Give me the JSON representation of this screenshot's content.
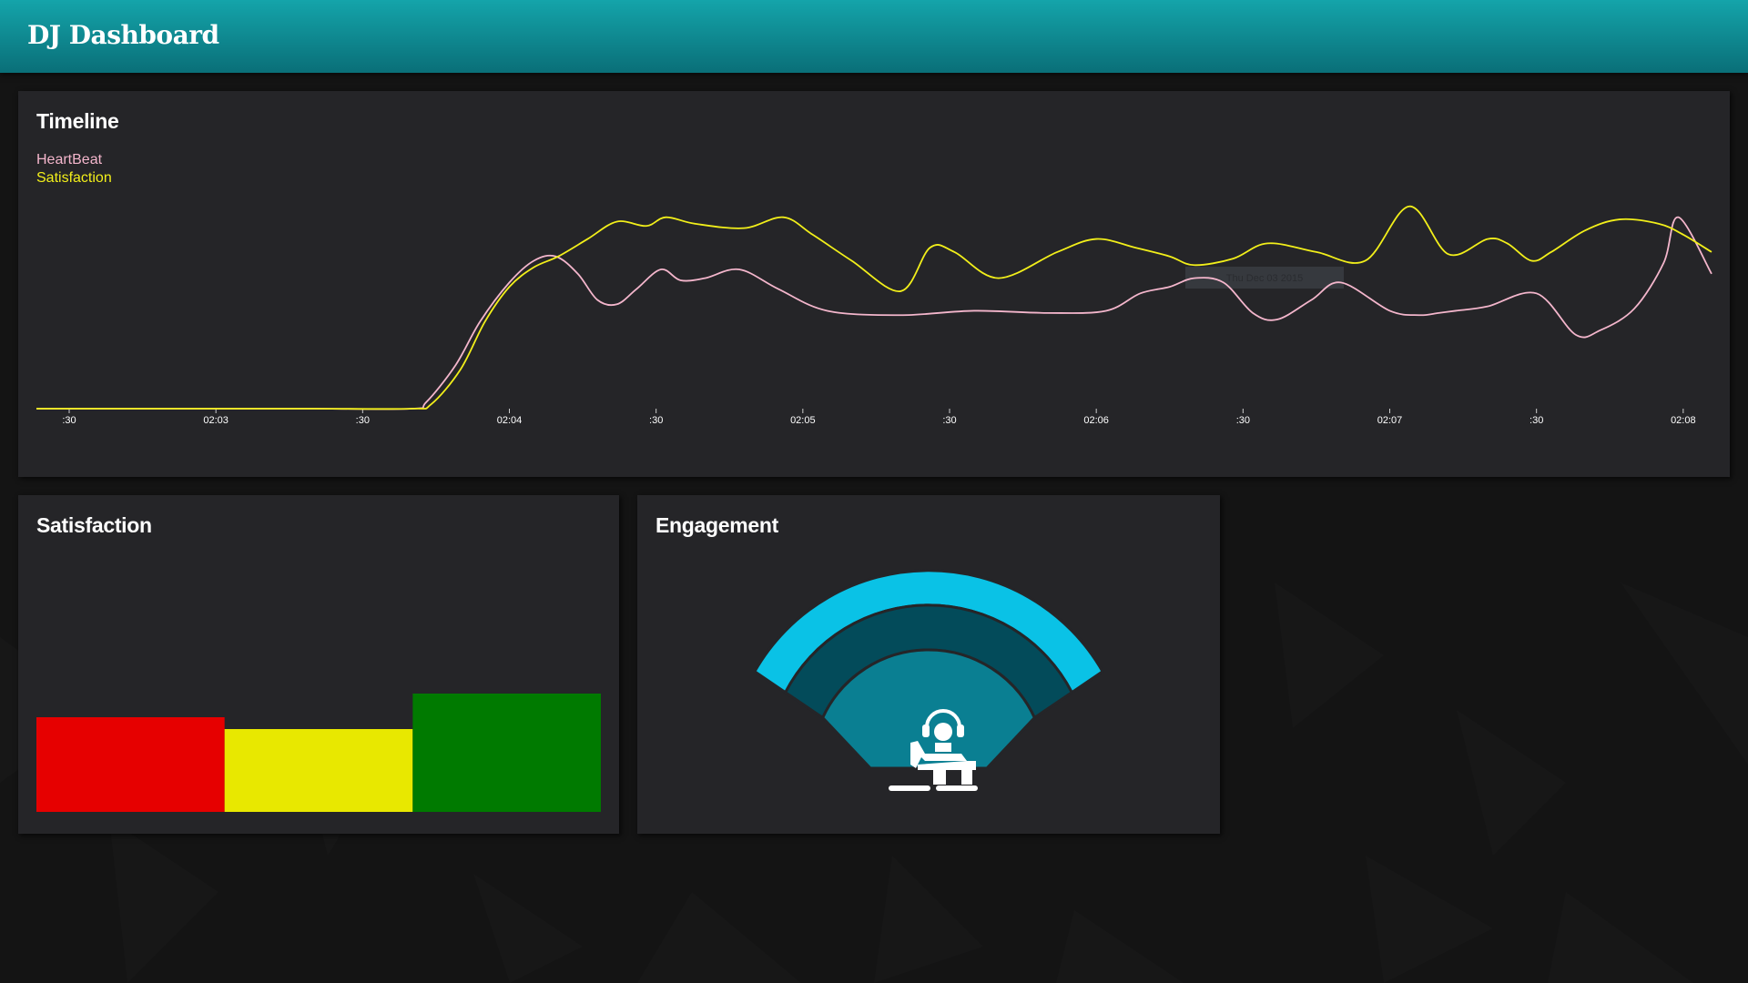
{
  "header": {
    "title": "DJ Dashboard"
  },
  "timeline": {
    "title": "Timeline",
    "tooltip": "Thu Dec 03 2015"
  },
  "satisfaction": {
    "title": "Satisfaction"
  },
  "engagement": {
    "title": "Engagement"
  },
  "colors": {
    "header": "#0f8a92",
    "card": "#252528",
    "heartbeat": "#f4b6cc",
    "satisfaction": "#f2ef1a",
    "bad": "#e60000",
    "neutral": "#e8e800",
    "good": "#007a00",
    "wave_outer": "#0ac2e6",
    "wave_middle": "#034b5a",
    "wave_inner": "#0a7f92"
  },
  "chart_data": [
    {
      "type": "line",
      "x_ticks": [
        ":30",
        "02:03",
        ":30",
        "02:04",
        ":30",
        "02:05",
        ":30",
        "02:06",
        ":30",
        "02:07",
        ":30",
        "02:08"
      ],
      "x_tick_seconds": [
        150,
        180,
        210,
        240,
        270,
        300,
        330,
        360,
        390,
        420,
        450,
        480
      ],
      "x_range_seconds": [
        143.3,
        485.8
      ],
      "ylim": [
        0,
        100
      ],
      "legend_position": "top-left",
      "series": [
        {
          "name": "HeartBeat",
          "color": "#f4b6cc",
          "x": [
            143.3,
            160,
            180,
            200,
            220,
            223,
            229,
            234,
            240,
            245,
            249.5,
            254,
            258,
            262,
            266,
            271,
            275,
            280,
            287,
            295,
            305,
            320,
            335,
            350,
            362,
            369,
            375,
            380,
            386,
            392,
            397,
            404,
            410,
            420,
            426,
            430,
            433.5,
            440,
            450,
            458,
            463,
            470,
            476,
            479,
            485.8
          ],
          "y": [
            0,
            0,
            0,
            0,
            0,
            3,
            20,
            40,
            58,
            68,
            70,
            62,
            50,
            48,
            55,
            64,
            59,
            60,
            64,
            55,
            45,
            43,
            45,
            44,
            45,
            53,
            56,
            60,
            58,
            44,
            41,
            50,
            58,
            45,
            43,
            44,
            45,
            47,
            53,
            34,
            36,
            46,
            67,
            88,
            62
          ]
        },
        {
          "name": "Satisfaction",
          "color": "#f2ef1a",
          "x": [
            143.3,
            160,
            180,
            200,
            220,
            224,
            230,
            235,
            240,
            245,
            250,
            256,
            262,
            268,
            272,
            278,
            288,
            296,
            302,
            310,
            320,
            326,
            331,
            340,
            352,
            360,
            368,
            375,
            380,
            388,
            395,
            405,
            415,
            424,
            432,
            440,
            444,
            449,
            453,
            460,
            467,
            475,
            480,
            485.8
          ],
          "y": [
            0,
            0,
            0,
            0,
            0,
            2,
            18,
            40,
            56,
            65,
            70,
            78,
            86,
            84,
            88,
            85,
            83,
            88,
            80,
            68,
            54,
            74,
            72,
            60,
            72,
            78,
            74,
            70,
            66,
            69,
            76,
            72,
            68,
            93,
            71,
            78,
            76,
            68,
            72,
            82,
            87,
            85,
            80,
            72
          ]
        }
      ]
    },
    {
      "type": "bar",
      "categories": [
        "",
        "",
        ""
      ],
      "values": [
        40,
        35,
        50
      ],
      "ylim": [
        0,
        100
      ],
      "colors": [
        "#e60000",
        "#e8e800",
        "#007a00"
      ]
    }
  ]
}
